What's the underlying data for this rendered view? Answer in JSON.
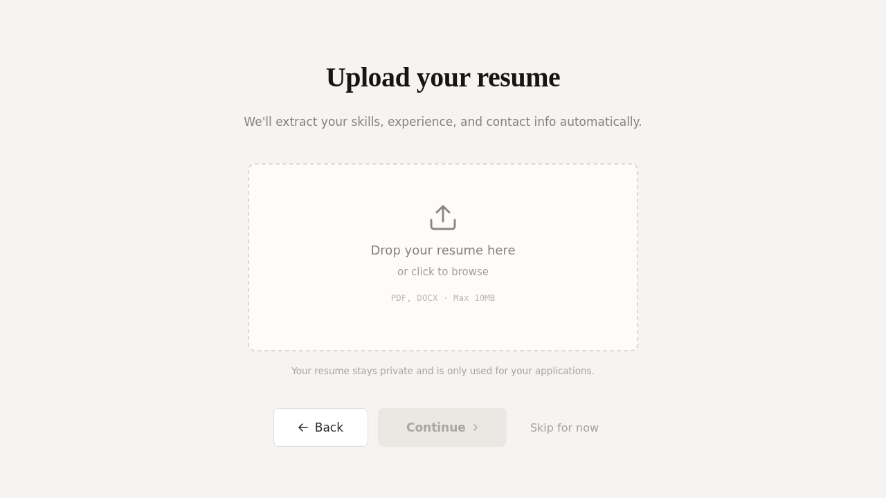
{
  "title": "Upload your resume",
  "subtitle": "We'll extract your skills, experience, and contact info automatically.",
  "dropzone": {
    "heading": "Drop your resume here",
    "hint": "or click to browse",
    "formats": "PDF, DOCX · Max 10MB"
  },
  "privacy_note": "Your resume stays private and is only used for your applications.",
  "buttons": [
    {
      "kind": "back",
      "label": "Back",
      "disabled": false
    },
    {
      "kind": "continue",
      "label": "Continue",
      "disabled": true
    },
    {
      "kind": "skip",
      "label": "Skip for now",
      "disabled": false
    }
  ]
}
